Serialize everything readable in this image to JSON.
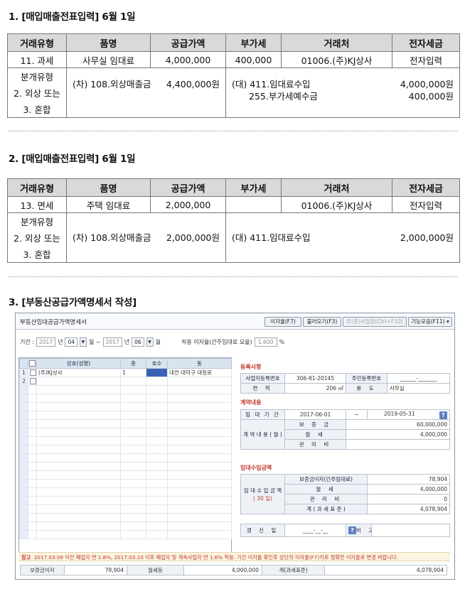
{
  "section1": {
    "title": "1. [매입매출전표입력] 6월 1일",
    "headers": [
      "거래유형",
      "품명",
      "공급가액",
      "부가세",
      "거래처",
      "전자세금"
    ],
    "row": [
      "11. 과세",
      "사무실 임대료",
      "4,000,000",
      "400,000",
      "01006.(주)KJ상사",
      "전자입력"
    ],
    "type_lines": [
      "분개유형",
      "2. 외상 또는",
      "3. 혼합"
    ],
    "debit": [
      {
        "account": "(차) 108.외상매출금",
        "amount": "4,400,000원"
      }
    ],
    "credit": [
      {
        "account": "(대) 411.임대료수입",
        "amount": "4,000,000원"
      },
      {
        "account": "255.부가세예수금",
        "amount": "400,000원"
      }
    ]
  },
  "section2": {
    "title": "2. [매입매출전표입력] 6월 1일",
    "headers": [
      "거래유형",
      "품명",
      "공급가액",
      "부가세",
      "거래처",
      "전자세금"
    ],
    "row": [
      "13. 면세",
      "주택 임대료",
      "2,000,000",
      "",
      "01006.(주)KJ상사",
      "전자입력"
    ],
    "type_lines": [
      "분개유형",
      "2. 외상 또는",
      "3. 혼합"
    ],
    "debit": [
      {
        "account": "(차) 108.외상매출금",
        "amount": "2,000,000원"
      }
    ],
    "credit": [
      {
        "account": "(대) 411.임대료수입",
        "amount": "2,000,000원"
      }
    ]
  },
  "section3": {
    "title": "3. [부동산공급가액명세서 작성]"
  },
  "window": {
    "title": "부동산임대공급가액명세서",
    "buttons": [
      "이자율(F7)",
      "불러오기(F3)",
      "주(종)사업장(Ctrl+F10)",
      "기능모음(F11) ▾"
    ],
    "period": {
      "label": "기간 :",
      "from_year": "2017",
      "year_suffix": "년",
      "from_month": "04",
      "month_suffix": "월 ~",
      "to_year": "2017",
      "to_month": "06",
      "to_month_suffix": "월",
      "rate_label": "적용 이자율(간주임대료 요율)",
      "rate": "1,600",
      "rate_unit": "%"
    },
    "grid": {
      "headers": [
        "",
        "상호(성명)",
        "층",
        "호수",
        "동"
      ],
      "rows": [
        {
          "no": "1",
          "name": "(주)KJ상사",
          "floor": "1",
          "room": "",
          "dong": "대전 대덕구 대청로"
        },
        {
          "no": "2",
          "name": "",
          "floor": "",
          "room": "",
          "dong": ""
        }
      ]
    },
    "reg": {
      "title": "등록사항",
      "bizno_label": "사업자등록번호",
      "bizno": "306-81-20145",
      "resno_label": "주민등록번호",
      "resno": "______-_______",
      "area_label": "면 적",
      "area": "206",
      "area_unit": "㎡",
      "use_label": "용 도",
      "use": "사무실"
    },
    "contract": {
      "title": "계약내용",
      "period_label": "임 대 기 간",
      "start": "2017-06-01",
      "tilde": "~",
      "end": "2019-05-31",
      "content_label": "계 약 내 용 ( 월 )",
      "deposit_label": "보 증 금",
      "deposit": "60,000,000",
      "monthly_label": "월 세",
      "monthly": "4,000,000",
      "mgmt_label": "관 리 비",
      "mgmt": ""
    },
    "income": {
      "title": "임대수입금액",
      "side_label": "임 대 수 입 금 액",
      "days": "( 30 일)",
      "interest_label": "보증금이자(간주임대료)",
      "interest": "78,904",
      "monthly_label": "월 세",
      "monthly": "4,000,000",
      "mgmt_label": "관 리 비",
      "mgmt": "0",
      "total_label": "계 ( 과 세 표 준 )",
      "total": "4,078,904",
      "renew_label": "갱 신 일",
      "renew": "____-__-__",
      "note_label": "비 고",
      "note": ""
    },
    "notice": {
      "label": "참고",
      "text": "2017.03.09 이전 폐업자 연 1.8%, 2017.03.10 이후 폐업자 및 계속사업자 연 1.6% 적용. 기간 이자율 확인후 상단의 이자율(F7)키로 정확한 이자율로 변경 바랍니다."
    },
    "totals": [
      {
        "label": "보증금이자",
        "value": "78,904"
      },
      {
        "label": "월세등",
        "value": "4,000,000"
      },
      {
        "label": "계(과세표준)",
        "value": "4,078,904"
      }
    ]
  }
}
